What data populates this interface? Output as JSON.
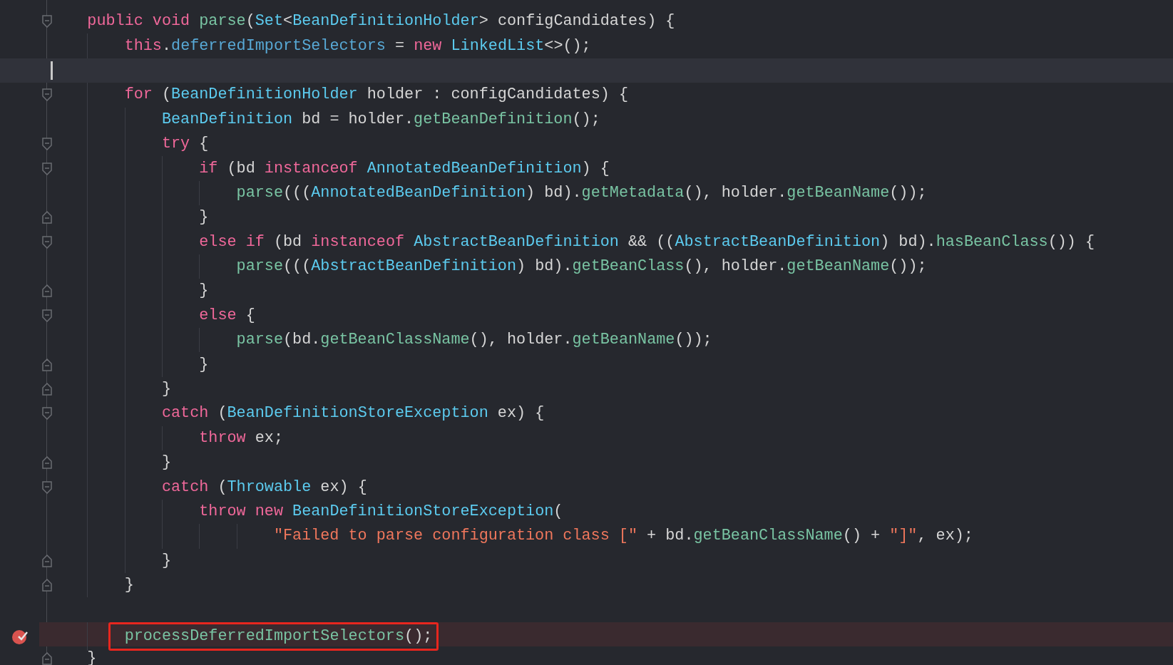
{
  "editor": {
    "lines": [
      {
        "fold_start": true,
        "fold_end": false,
        "current": false,
        "breakpoint": false,
        "boxed": false,
        "tokens": [
          {
            "kind": "kw",
            "text": "public void "
          },
          {
            "kind": "fn",
            "text": "parse"
          },
          {
            "kind": "plain",
            "text": "("
          },
          {
            "kind": "type",
            "text": "Set"
          },
          {
            "kind": "plain",
            "text": "<"
          },
          {
            "kind": "type",
            "text": "BeanDefinitionHolder"
          },
          {
            "kind": "plain",
            "text": "> configCandidates) {"
          }
        ],
        "children": [
          {
            "fold_start": false,
            "fold_end": false,
            "current": false,
            "breakpoint": false,
            "boxed": false,
            "tokens": [
              {
                "kind": "kw",
                "text": "this"
              },
              {
                "kind": "plain",
                "text": "."
              },
              {
                "kind": "field",
                "text": "deferredImportSelectors"
              },
              {
                "kind": "plain",
                "text": " = "
              },
              {
                "kind": "kw",
                "text": "new "
              },
              {
                "kind": "type",
                "text": "LinkedList"
              },
              {
                "kind": "plain",
                "text": "<>();"
              }
            ]
          },
          {
            "fold_start": false,
            "fold_end": false,
            "current": true,
            "breakpoint": false,
            "boxed": false
          },
          {
            "fold_start": true,
            "fold_end": false,
            "current": false,
            "breakpoint": false,
            "boxed": false,
            "tokens": [
              {
                "kind": "kw",
                "text": "for "
              },
              {
                "kind": "plain",
                "text": "("
              },
              {
                "kind": "type",
                "text": "BeanDefinitionHolder"
              },
              {
                "kind": "plain",
                "text": " holder : configCandidates) {"
              }
            ],
            "children": [
              {
                "fold_start": false,
                "fold_end": false,
                "current": false,
                "breakpoint": false,
                "boxed": false,
                "tokens": [
                  {
                    "kind": "type",
                    "text": "BeanDefinition"
                  },
                  {
                    "kind": "plain",
                    "text": " bd = holder."
                  },
                  {
                    "kind": "fn",
                    "text": "getBeanDefinition"
                  },
                  {
                    "kind": "plain",
                    "text": "();"
                  }
                ]
              },
              {
                "fold_start": true,
                "fold_end": false,
                "current": false,
                "breakpoint": false,
                "boxed": false,
                "tokens": [
                  {
                    "kind": "kw",
                    "text": "try "
                  },
                  {
                    "kind": "plain",
                    "text": "{"
                  }
                ],
                "children": [
                  {
                    "fold_start": true,
                    "fold_end": false,
                    "current": false,
                    "breakpoint": false,
                    "boxed": false,
                    "tokens": [
                      {
                        "kind": "kw",
                        "text": "if "
                      },
                      {
                        "kind": "plain",
                        "text": "(bd "
                      },
                      {
                        "kind": "kw",
                        "text": "instanceof "
                      },
                      {
                        "kind": "type",
                        "text": "AnnotatedBeanDefinition"
                      },
                      {
                        "kind": "plain",
                        "text": ") {"
                      }
                    ],
                    "children": [
                      {
                        "fold_start": false,
                        "fold_end": false,
                        "current": false,
                        "breakpoint": false,
                        "boxed": false,
                        "tokens": [
                          {
                            "kind": "fn",
                            "text": "parse"
                          },
                          {
                            "kind": "plain",
                            "text": "((("
                          },
                          {
                            "kind": "type",
                            "text": "AnnotatedBeanDefinition"
                          },
                          {
                            "kind": "plain",
                            "text": ") bd)."
                          },
                          {
                            "kind": "fn",
                            "text": "getMetadata"
                          },
                          {
                            "kind": "plain",
                            "text": "(), holder."
                          },
                          {
                            "kind": "fn",
                            "text": "getBeanName"
                          },
                          {
                            "kind": "plain",
                            "text": "());"
                          }
                        ]
                      }
                    ]
                  },
                  {
                    "fold_start": false,
                    "fold_end": true,
                    "current": false,
                    "breakpoint": false,
                    "boxed": false,
                    "tokens": [
                      {
                        "kind": "plain",
                        "text": "}"
                      }
                    ]
                  },
                  {
                    "fold_start": true,
                    "fold_end": false,
                    "current": false,
                    "breakpoint": false,
                    "boxed": false,
                    "tokens": [
                      {
                        "kind": "kw",
                        "text": "else if "
                      },
                      {
                        "kind": "plain",
                        "text": "(bd "
                      },
                      {
                        "kind": "kw",
                        "text": "instanceof "
                      },
                      {
                        "kind": "type",
                        "text": "AbstractBeanDefinition"
                      },
                      {
                        "kind": "plain",
                        "text": " && (("
                      },
                      {
                        "kind": "type",
                        "text": "AbstractBeanDefinition"
                      },
                      {
                        "kind": "plain",
                        "text": ") bd)."
                      },
                      {
                        "kind": "fn",
                        "text": "hasBeanClass"
                      },
                      {
                        "kind": "plain",
                        "text": "()) {"
                      }
                    ],
                    "children": [
                      {
                        "fold_start": false,
                        "fold_end": false,
                        "current": false,
                        "breakpoint": false,
                        "boxed": false,
                        "tokens": [
                          {
                            "kind": "fn",
                            "text": "parse"
                          },
                          {
                            "kind": "plain",
                            "text": "((("
                          },
                          {
                            "kind": "type",
                            "text": "AbstractBeanDefinition"
                          },
                          {
                            "kind": "plain",
                            "text": ") bd)."
                          },
                          {
                            "kind": "fn",
                            "text": "getBeanClass"
                          },
                          {
                            "kind": "plain",
                            "text": "(), holder."
                          },
                          {
                            "kind": "fn",
                            "text": "getBeanName"
                          },
                          {
                            "kind": "plain",
                            "text": "());"
                          }
                        ]
                      }
                    ]
                  },
                  {
                    "fold_start": false,
                    "fold_end": true,
                    "current": false,
                    "breakpoint": false,
                    "boxed": false,
                    "tokens": [
                      {
                        "kind": "plain",
                        "text": "}"
                      }
                    ]
                  },
                  {
                    "fold_start": true,
                    "fold_end": false,
                    "current": false,
                    "breakpoint": false,
                    "boxed": false,
                    "tokens": [
                      {
                        "kind": "kw",
                        "text": "else "
                      },
                      {
                        "kind": "plain",
                        "text": "{"
                      }
                    ],
                    "children": [
                      {
                        "fold_start": false,
                        "fold_end": false,
                        "current": false,
                        "breakpoint": false,
                        "boxed": false,
                        "tokens": [
                          {
                            "kind": "fn",
                            "text": "parse"
                          },
                          {
                            "kind": "plain",
                            "text": "(bd."
                          },
                          {
                            "kind": "fn",
                            "text": "getBeanClassName"
                          },
                          {
                            "kind": "plain",
                            "text": "(), holder."
                          },
                          {
                            "kind": "fn",
                            "text": "getBeanName"
                          },
                          {
                            "kind": "plain",
                            "text": "());"
                          }
                        ]
                      }
                    ]
                  },
                  {
                    "fold_start": false,
                    "fold_end": true,
                    "current": false,
                    "breakpoint": false,
                    "boxed": false,
                    "tokens": [
                      {
                        "kind": "plain",
                        "text": "}"
                      }
                    ]
                  }
                ]
              },
              {
                "fold_start": false,
                "fold_end": true,
                "current": false,
                "breakpoint": false,
                "boxed": false,
                "tokens": [
                  {
                    "kind": "plain",
                    "text": "}"
                  }
                ]
              },
              {
                "fold_start": true,
                "fold_end": false,
                "current": false,
                "breakpoint": false,
                "boxed": false,
                "tokens": [
                  {
                    "kind": "kw",
                    "text": "catch "
                  },
                  {
                    "kind": "plain",
                    "text": "("
                  },
                  {
                    "kind": "type",
                    "text": "BeanDefinitionStoreException"
                  },
                  {
                    "kind": "plain",
                    "text": " ex) {"
                  }
                ],
                "children": [
                  {
                    "fold_start": false,
                    "fold_end": false,
                    "current": false,
                    "breakpoint": false,
                    "boxed": false,
                    "tokens": [
                      {
                        "kind": "kw",
                        "text": "throw "
                      },
                      {
                        "kind": "plain",
                        "text": "ex;"
                      }
                    ]
                  }
                ]
              },
              {
                "fold_start": false,
                "fold_end": true,
                "current": false,
                "breakpoint": false,
                "boxed": false,
                "tokens": [
                  {
                    "kind": "plain",
                    "text": "}"
                  }
                ]
              },
              {
                "fold_start": true,
                "fold_end": false,
                "current": false,
                "breakpoint": false,
                "boxed": false,
                "tokens": [
                  {
                    "kind": "kw",
                    "text": "catch "
                  },
                  {
                    "kind": "plain",
                    "text": "("
                  },
                  {
                    "kind": "type",
                    "text": "Throwable"
                  },
                  {
                    "kind": "plain",
                    "text": " ex) {"
                  }
                ],
                "children": [
                  {
                    "fold_start": false,
                    "fold_end": false,
                    "current": false,
                    "breakpoint": false,
                    "boxed": false,
                    "tokens": [
                      {
                        "kind": "kw",
                        "text": "throw new "
                      },
                      {
                        "kind": "type",
                        "text": "BeanDefinitionStoreException"
                      },
                      {
                        "kind": "plain",
                        "text": "("
                      }
                    ],
                    "children": [
                      {
                        "fold_start": false,
                        "fold_end": false,
                        "current": false,
                        "breakpoint": false,
                        "boxed": false,
                        "tokens": [
                          {
                            "kind": "str",
                            "text": "\"Failed to parse configuration class [\""
                          },
                          {
                            "kind": "plain",
                            "text": " + bd."
                          },
                          {
                            "kind": "fn",
                            "text": "getBeanClassName"
                          },
                          {
                            "kind": "plain",
                            "text": "() + "
                          },
                          {
                            "kind": "str",
                            "text": "\"]\""
                          },
                          {
                            "kind": "plain",
                            "text": ", ex);"
                          }
                        ]
                      }
                    ]
                  }
                ]
              },
              {
                "fold_start": false,
                "fold_end": true,
                "current": false,
                "breakpoint": false,
                "boxed": false,
                "tokens": [
                  {
                    "kind": "plain",
                    "text": "}"
                  }
                ]
              }
            ]
          },
          {
            "fold_start": false,
            "fold_end": true,
            "current": false,
            "breakpoint": false,
            "boxed": false,
            "tokens": [
              {
                "kind": "plain",
                "text": "}"
              }
            ]
          },
          {
            "fold_start": false,
            "fold_end": false,
            "current": false,
            "breakpoint": false,
            "boxed": false
          },
          {
            "fold_start": false,
            "fold_end": false,
            "current": false,
            "breakpoint": true,
            "boxed": true,
            "tokens": [
              {
                "kind": "fn",
                "text": "processDeferredImportSelectors"
              },
              {
                "kind": "plain",
                "text": "();"
              }
            ]
          }
        ]
      },
      {
        "fold_start": false,
        "fold_end": true,
        "current": false,
        "breakpoint": false,
        "boxed": false,
        "tokens": [
          {
            "kind": "plain",
            "text": "}"
          }
        ]
      }
    ]
  }
}
